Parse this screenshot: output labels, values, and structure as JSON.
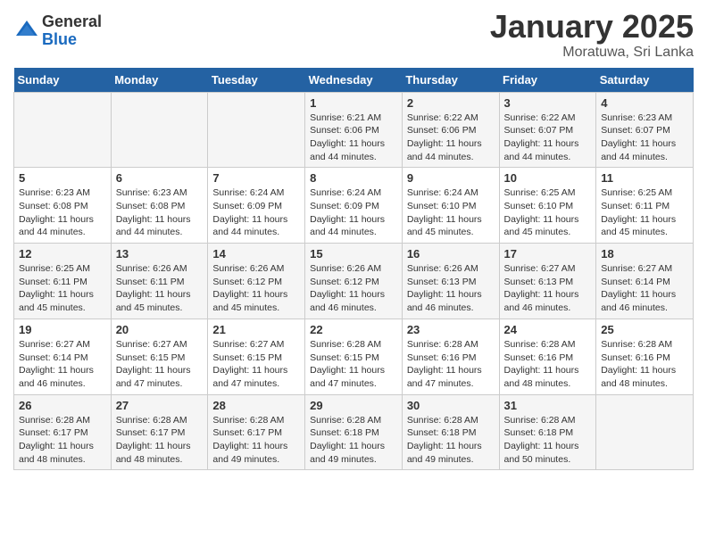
{
  "header": {
    "logo_general": "General",
    "logo_blue": "Blue",
    "title": "January 2025",
    "subtitle": "Moratuwa, Sri Lanka"
  },
  "days_of_week": [
    "Sunday",
    "Monday",
    "Tuesday",
    "Wednesday",
    "Thursday",
    "Friday",
    "Saturday"
  ],
  "weeks": [
    [
      {
        "day": "",
        "info": ""
      },
      {
        "day": "",
        "info": ""
      },
      {
        "day": "",
        "info": ""
      },
      {
        "day": "1",
        "info": "Sunrise: 6:21 AM\nSunset: 6:06 PM\nDaylight: 11 hours and 44 minutes."
      },
      {
        "day": "2",
        "info": "Sunrise: 6:22 AM\nSunset: 6:06 PM\nDaylight: 11 hours and 44 minutes."
      },
      {
        "day": "3",
        "info": "Sunrise: 6:22 AM\nSunset: 6:07 PM\nDaylight: 11 hours and 44 minutes."
      },
      {
        "day": "4",
        "info": "Sunrise: 6:23 AM\nSunset: 6:07 PM\nDaylight: 11 hours and 44 minutes."
      }
    ],
    [
      {
        "day": "5",
        "info": "Sunrise: 6:23 AM\nSunset: 6:08 PM\nDaylight: 11 hours and 44 minutes."
      },
      {
        "day": "6",
        "info": "Sunrise: 6:23 AM\nSunset: 6:08 PM\nDaylight: 11 hours and 44 minutes."
      },
      {
        "day": "7",
        "info": "Sunrise: 6:24 AM\nSunset: 6:09 PM\nDaylight: 11 hours and 44 minutes."
      },
      {
        "day": "8",
        "info": "Sunrise: 6:24 AM\nSunset: 6:09 PM\nDaylight: 11 hours and 44 minutes."
      },
      {
        "day": "9",
        "info": "Sunrise: 6:24 AM\nSunset: 6:10 PM\nDaylight: 11 hours and 45 minutes."
      },
      {
        "day": "10",
        "info": "Sunrise: 6:25 AM\nSunset: 6:10 PM\nDaylight: 11 hours and 45 minutes."
      },
      {
        "day": "11",
        "info": "Sunrise: 6:25 AM\nSunset: 6:11 PM\nDaylight: 11 hours and 45 minutes."
      }
    ],
    [
      {
        "day": "12",
        "info": "Sunrise: 6:25 AM\nSunset: 6:11 PM\nDaylight: 11 hours and 45 minutes."
      },
      {
        "day": "13",
        "info": "Sunrise: 6:26 AM\nSunset: 6:11 PM\nDaylight: 11 hours and 45 minutes."
      },
      {
        "day": "14",
        "info": "Sunrise: 6:26 AM\nSunset: 6:12 PM\nDaylight: 11 hours and 45 minutes."
      },
      {
        "day": "15",
        "info": "Sunrise: 6:26 AM\nSunset: 6:12 PM\nDaylight: 11 hours and 46 minutes."
      },
      {
        "day": "16",
        "info": "Sunrise: 6:26 AM\nSunset: 6:13 PM\nDaylight: 11 hours and 46 minutes."
      },
      {
        "day": "17",
        "info": "Sunrise: 6:27 AM\nSunset: 6:13 PM\nDaylight: 11 hours and 46 minutes."
      },
      {
        "day": "18",
        "info": "Sunrise: 6:27 AM\nSunset: 6:14 PM\nDaylight: 11 hours and 46 minutes."
      }
    ],
    [
      {
        "day": "19",
        "info": "Sunrise: 6:27 AM\nSunset: 6:14 PM\nDaylight: 11 hours and 46 minutes."
      },
      {
        "day": "20",
        "info": "Sunrise: 6:27 AM\nSunset: 6:15 PM\nDaylight: 11 hours and 47 minutes."
      },
      {
        "day": "21",
        "info": "Sunrise: 6:27 AM\nSunset: 6:15 PM\nDaylight: 11 hours and 47 minutes."
      },
      {
        "day": "22",
        "info": "Sunrise: 6:28 AM\nSunset: 6:15 PM\nDaylight: 11 hours and 47 minutes."
      },
      {
        "day": "23",
        "info": "Sunrise: 6:28 AM\nSunset: 6:16 PM\nDaylight: 11 hours and 47 minutes."
      },
      {
        "day": "24",
        "info": "Sunrise: 6:28 AM\nSunset: 6:16 PM\nDaylight: 11 hours and 48 minutes."
      },
      {
        "day": "25",
        "info": "Sunrise: 6:28 AM\nSunset: 6:16 PM\nDaylight: 11 hours and 48 minutes."
      }
    ],
    [
      {
        "day": "26",
        "info": "Sunrise: 6:28 AM\nSunset: 6:17 PM\nDaylight: 11 hours and 48 minutes."
      },
      {
        "day": "27",
        "info": "Sunrise: 6:28 AM\nSunset: 6:17 PM\nDaylight: 11 hours and 48 minutes."
      },
      {
        "day": "28",
        "info": "Sunrise: 6:28 AM\nSunset: 6:17 PM\nDaylight: 11 hours and 49 minutes."
      },
      {
        "day": "29",
        "info": "Sunrise: 6:28 AM\nSunset: 6:18 PM\nDaylight: 11 hours and 49 minutes."
      },
      {
        "day": "30",
        "info": "Sunrise: 6:28 AM\nSunset: 6:18 PM\nDaylight: 11 hours and 49 minutes."
      },
      {
        "day": "31",
        "info": "Sunrise: 6:28 AM\nSunset: 6:18 PM\nDaylight: 11 hours and 50 minutes."
      },
      {
        "day": "",
        "info": ""
      }
    ]
  ]
}
